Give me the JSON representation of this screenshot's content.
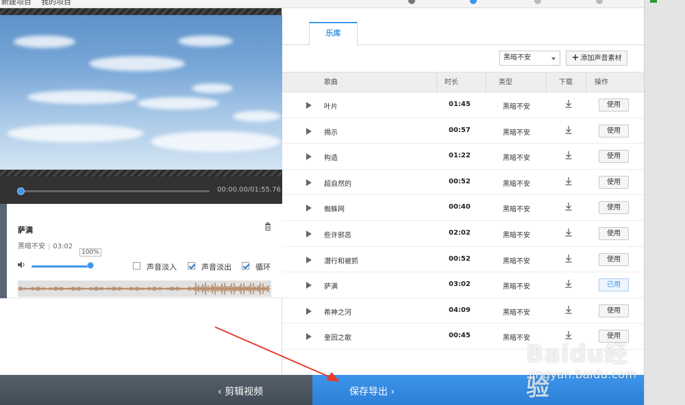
{
  "topbar": {
    "items": [
      "新建项目",
      "我的项目"
    ]
  },
  "player": {
    "time": "00:00.00/01:55.76"
  },
  "clip": {
    "name": "萨满",
    "type": "黑暗不安",
    "duration": "03:02",
    "volume": "100%",
    "volume_level": 1.0,
    "options": [
      {
        "label": "声音淡入",
        "checked": false
      },
      {
        "label": "声音淡出",
        "checked": true
      },
      {
        "label": "循环",
        "checked": true
      }
    ]
  },
  "library": {
    "tab": "乐库",
    "filter": "黑暗不安",
    "add_button": "添加声音素材",
    "columns": {
      "song": "歌曲",
      "duration": "时长",
      "type": "类型",
      "download": "下载",
      "action": "操作"
    },
    "rows": [
      {
        "song": "叶片",
        "duration": "01:45",
        "type": "黑暗不安",
        "action": "使用"
      },
      {
        "song": "揭示",
        "duration": "00:57",
        "type": "黑暗不安",
        "action": "使用"
      },
      {
        "song": "构造",
        "duration": "01:22",
        "type": "黑暗不安",
        "action": "使用"
      },
      {
        "song": "超自然的",
        "duration": "00:52",
        "type": "黑暗不安",
        "action": "使用"
      },
      {
        "song": "蜘蛛网",
        "duration": "00:40",
        "type": "黑暗不安",
        "action": "使用"
      },
      {
        "song": "些许邪恶",
        "duration": "02:02",
        "type": "黑暗不安",
        "action": "使用"
      },
      {
        "song": "潜行和被抓",
        "duration": "00:52",
        "type": "黑暗不安",
        "action": "使用"
      },
      {
        "song": "萨满",
        "duration": "03:02",
        "type": "黑暗不安",
        "action": "已用"
      },
      {
        "song": "希神之河",
        "duration": "04:09",
        "type": "黑暗不安",
        "action": "使用"
      },
      {
        "song": "奎因之歌",
        "duration": "00:45",
        "type": "黑暗不安",
        "action": "使用"
      }
    ]
  },
  "footer": {
    "back": "剪辑视频",
    "next": "保存导出"
  },
  "watermark": {
    "logo": "Baidu经验",
    "url": "jingyan.baidu.com"
  },
  "colors": {
    "accent": "#3d95ea",
    "dark": "#323232"
  }
}
